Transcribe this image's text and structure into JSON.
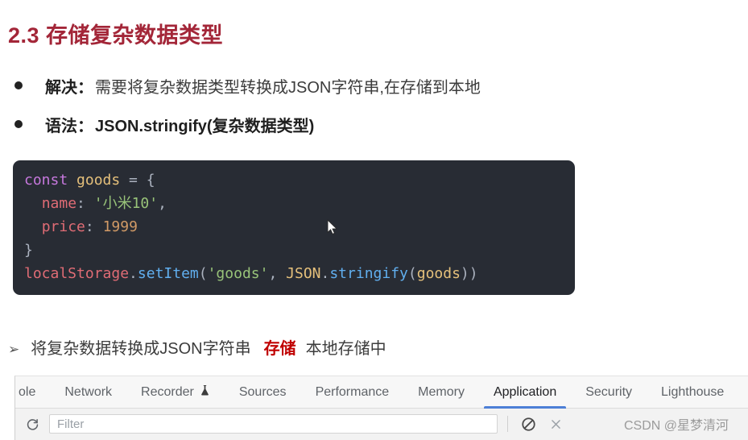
{
  "slide": {
    "title": "2.3 存储复杂数据类型",
    "bullets": [
      {
        "label": "解决：",
        "text": "需要将复杂数据类型转换成JSON字符串,在存储到本地",
        "bold": false
      },
      {
        "label": "语法：",
        "text": "JSON.stringify(复杂数据类型)",
        "bold": true
      }
    ],
    "code": {
      "lines": [
        [
          {
            "t": "const",
            "c": "c-key"
          },
          {
            "t": " ",
            "c": "c-punct"
          },
          {
            "t": "goods",
            "c": "c-var"
          },
          {
            "t": " = {",
            "c": "c-punct"
          }
        ],
        [
          {
            "t": "  ",
            "c": "c-punct"
          },
          {
            "t": "name",
            "c": "c-prop"
          },
          {
            "t": ": ",
            "c": "c-punct"
          },
          {
            "t": "'小米10'",
            "c": "c-str"
          },
          {
            "t": ",",
            "c": "c-punct"
          }
        ],
        [
          {
            "t": "  ",
            "c": "c-punct"
          },
          {
            "t": "price",
            "c": "c-prop"
          },
          {
            "t": ": ",
            "c": "c-punct"
          },
          {
            "t": "1999",
            "c": "c-num"
          }
        ],
        [
          {
            "t": "}",
            "c": "c-punct"
          }
        ],
        [
          {
            "t": "localStorage",
            "c": "c-obj"
          },
          {
            "t": ".",
            "c": "c-punct"
          },
          {
            "t": "setItem",
            "c": "c-fn"
          },
          {
            "t": "(",
            "c": "c-punct"
          },
          {
            "t": "'goods'",
            "c": "c-str"
          },
          {
            "t": ", ",
            "c": "c-punct"
          },
          {
            "t": "JSON",
            "c": "c-cls"
          },
          {
            "t": ".",
            "c": "c-punct"
          },
          {
            "t": "stringify",
            "c": "c-fn"
          },
          {
            "t": "(",
            "c": "c-punct"
          },
          {
            "t": "goods",
            "c": "c-var"
          },
          {
            "t": "))",
            "c": "c-punct"
          }
        ]
      ],
      "background_color": "#282c34"
    },
    "note": {
      "arrow": "➢",
      "text_before": "将复杂数据转换成JSON字符串",
      "highlight": "存储",
      "highlight_color": "#c00000",
      "text_after": "本地存储中"
    },
    "title_color": "#a32638"
  },
  "devtools": {
    "tabs": [
      {
        "label": "ole",
        "active": false,
        "clipped": true,
        "icon": ""
      },
      {
        "label": "Network",
        "active": false,
        "clipped": false,
        "icon": ""
      },
      {
        "label": "Recorder",
        "active": false,
        "clipped": false,
        "icon": "flask-icon"
      },
      {
        "label": "Sources",
        "active": false,
        "clipped": false,
        "icon": ""
      },
      {
        "label": "Performance",
        "active": false,
        "clipped": false,
        "icon": ""
      },
      {
        "label": "Memory",
        "active": false,
        "clipped": false,
        "icon": ""
      },
      {
        "label": "Application",
        "active": true,
        "clipped": false,
        "icon": ""
      },
      {
        "label": "Security",
        "active": false,
        "clipped": false,
        "icon": ""
      },
      {
        "label": "Lighthouse",
        "active": false,
        "clipped": false,
        "icon": ""
      }
    ],
    "active_tab_color": "#4d7fd6",
    "toolbar": {
      "refresh_icon": "refresh-icon",
      "filter_placeholder": "Filter",
      "filter_value": "",
      "clear_icon": "no-entry-icon",
      "close_icon": "close-icon"
    },
    "watermark": "CSDN @星梦清河"
  }
}
